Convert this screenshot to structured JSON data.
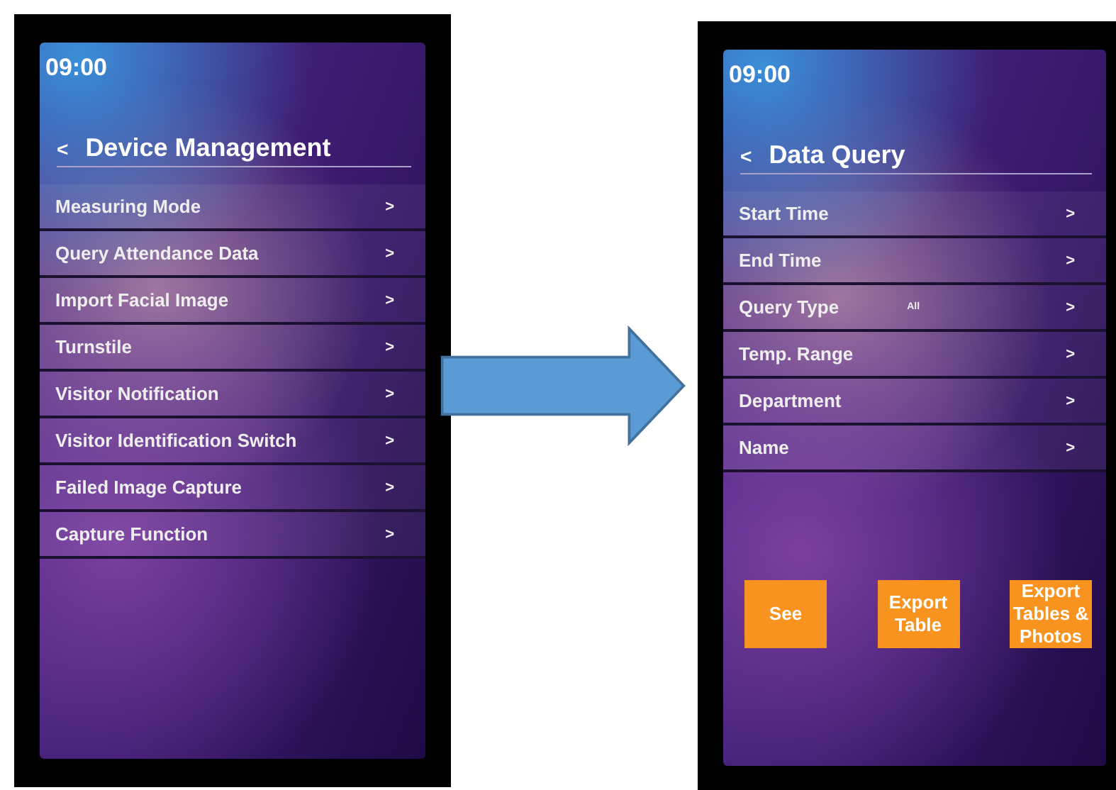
{
  "screens": [
    {
      "time": "09:00",
      "back": "<",
      "title": "Device Management",
      "items": [
        {
          "label": "Measuring Mode",
          "chevron": ">"
        },
        {
          "label": "Query Attendance Data",
          "chevron": ">"
        },
        {
          "label": "Import Facial Image",
          "chevron": ">"
        },
        {
          "label": "Turnstile",
          "chevron": ">"
        },
        {
          "label": "Visitor Notification",
          "chevron": ">"
        },
        {
          "label": "Visitor Identification Switch",
          "chevron": ">"
        },
        {
          "label": "Failed Image Capture",
          "chevron": ">"
        },
        {
          "label": "Capture Function",
          "chevron": ">"
        }
      ]
    },
    {
      "time": "09:00",
      "back": "<",
      "title": "Data Query",
      "items": [
        {
          "label": "Start Time",
          "chevron": ">"
        },
        {
          "label": "End Time",
          "chevron": ">"
        },
        {
          "label": "Query Type",
          "value": "All",
          "chevron": ">"
        },
        {
          "label": "Temp. Range",
          "chevron": ">"
        },
        {
          "label": "Department",
          "chevron": ">"
        },
        {
          "label": "Name",
          "chevron": ">"
        }
      ],
      "buttons": [
        "See",
        "Export Table",
        "Export Tables & Photos"
      ]
    }
  ]
}
